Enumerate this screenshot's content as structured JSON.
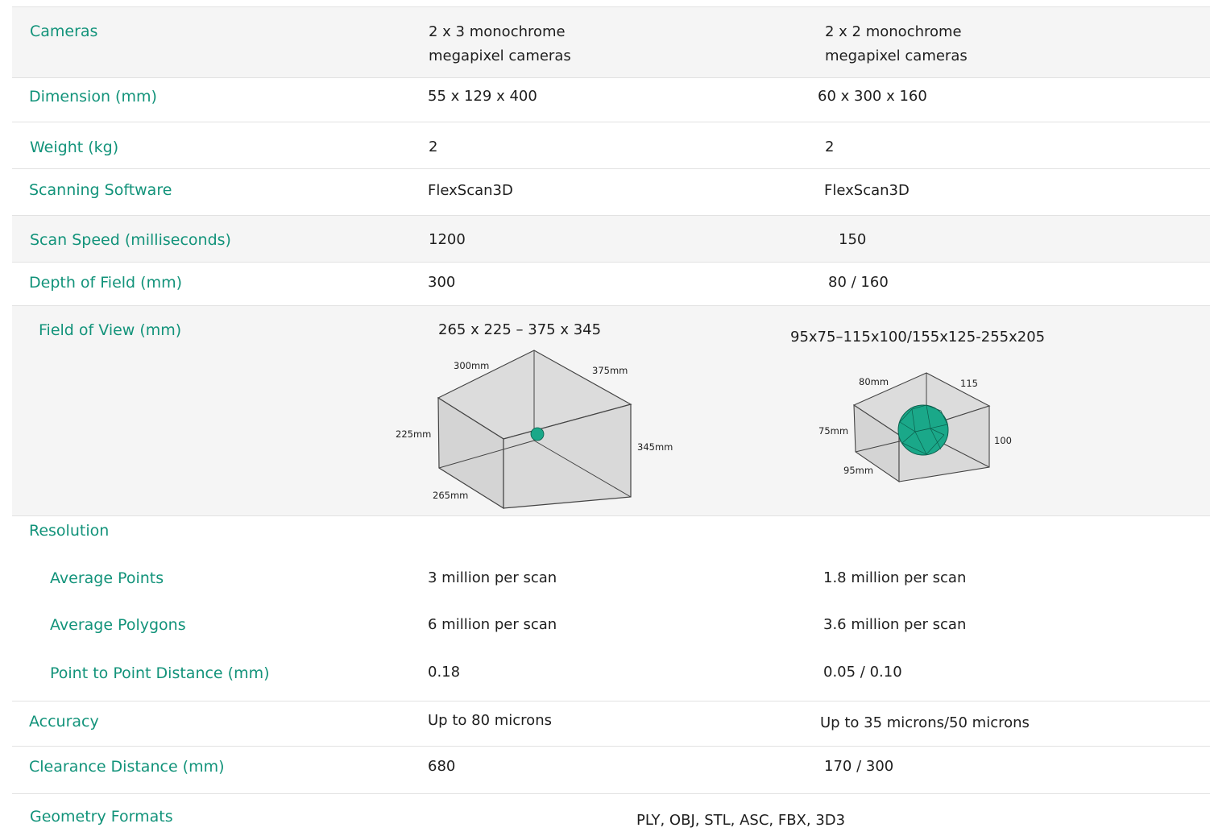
{
  "specs": {
    "cameras": {
      "label": "Cameras",
      "col1_line1": "2 x 3 monochrome",
      "col1_line2": "megapixel cameras",
      "col2_line1": "2 x 2 monochrome",
      "col2_line2": "megapixel cameras"
    },
    "dimension": {
      "label": "Dimension (mm)",
      "col1": "55 x 129 x 400",
      "col2": "60 x 300 x 160"
    },
    "weight": {
      "label": "Weight (kg)",
      "col1": "2",
      "col2": "2"
    },
    "software": {
      "label": "Scanning Software",
      "col1": "FlexScan3D",
      "col2": "FlexScan3D"
    },
    "scan_speed": {
      "label": "Scan Speed (milliseconds)",
      "col1": "1200",
      "col2": "150"
    },
    "depth_of_field": {
      "label": "Depth of Field (mm)",
      "col1": "300",
      "col2": "80 / 160"
    },
    "field_of_view": {
      "label": "Field of View (mm)",
      "col1": "265 x 225 – 375 x 345",
      "col2": "95x75–115x100/155x125-255x205",
      "diagram1": {
        "top_left": "300mm",
        "top_right": "375mm",
        "left": "225mm",
        "right": "345mm",
        "bottom": "265mm"
      },
      "diagram2": {
        "top_left": "80mm",
        "top_right": "115",
        "left": "75mm",
        "right": "100",
        "bottom": "95mm"
      }
    },
    "resolution": {
      "label": "Resolution",
      "avg_points": {
        "label": "Average Points",
        "col1": "3 million per scan",
        "col2": "1.8 million per scan"
      },
      "avg_polygons": {
        "label": "Average Polygons",
        "col1": "6 million per scan",
        "col2": "3.6 million per scan"
      },
      "point_distance": {
        "label": "Point to Point Distance (mm)",
        "col1": "0.18",
        "col2": "0.05 / 0.10"
      }
    },
    "accuracy": {
      "label": "Accuracy",
      "col1": "Up to 80 microns",
      "col2": "Up to 35 microns/50 microns"
    },
    "clearance": {
      "label": "Clearance Distance (mm)",
      "col1": "680",
      "col2": "170 / 300"
    },
    "geometry": {
      "label": "Geometry Formats",
      "value": "PLY, OBJ, STL, ASC, FBX, 3D3"
    }
  },
  "colors": {
    "label_teal": "#12937a",
    "sphere_teal": "#1aa889",
    "row_shade": "#f5f5f5"
  }
}
